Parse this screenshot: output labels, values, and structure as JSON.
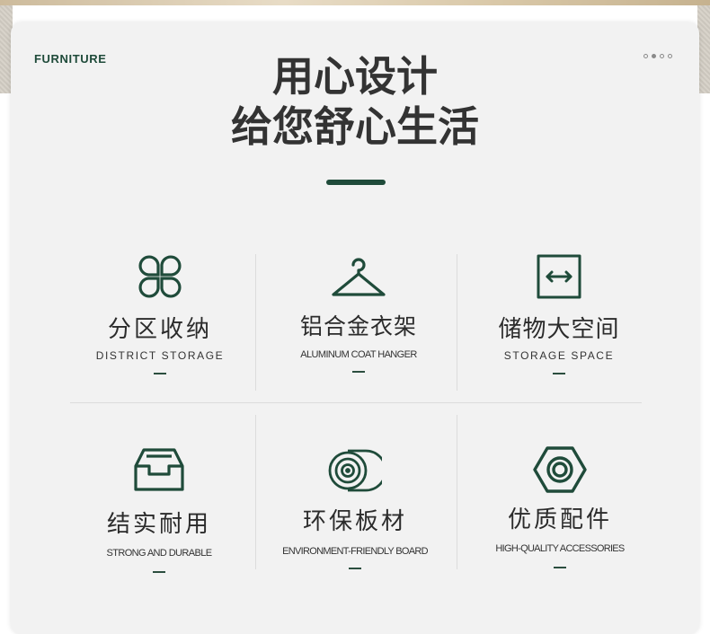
{
  "brand": "FURNITURE",
  "pager": {
    "count": 4,
    "active_index": 1
  },
  "headline": {
    "line1": "用心设计",
    "line2": "给您舒心生活"
  },
  "colors": {
    "accent": "#1f4b3a",
    "card_bg": "#f2f2f2",
    "text": "#333333"
  },
  "features": [
    {
      "icon": "clover-icon",
      "title": "分区收纳",
      "subtitle": "DISTRICT STORAGE"
    },
    {
      "icon": "hanger-icon",
      "title": "铝合金衣架",
      "subtitle": "ALUMINUM COAT HANGER"
    },
    {
      "icon": "expand-horizontal-icon",
      "title": "储物大空间",
      "subtitle": "STORAGE SPACE"
    },
    {
      "icon": "inbox-tray-icon",
      "title": "结实耐用",
      "subtitle": "STRONG AND DURABLE"
    },
    {
      "icon": "wood-log-icon",
      "title": "环保板材",
      "subtitle": "ENVIRONMENT-FRIENDLY BOARD"
    },
    {
      "icon": "hex-nut-icon",
      "title": "优质配件",
      "subtitle": "HIGH-QUALITY ACCESSORIES"
    }
  ]
}
